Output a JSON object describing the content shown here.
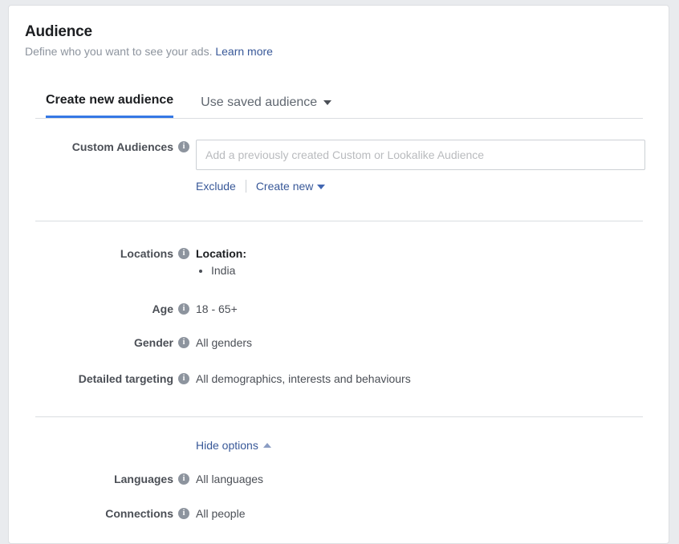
{
  "header": {
    "title": "Audience",
    "subtitle": "Define who you want to see your ads.",
    "learn_more": "Learn more"
  },
  "tabs": [
    {
      "label": "Create new audience",
      "active": true
    },
    {
      "label": "Use saved audience",
      "active": false,
      "icon": "chevron-down-icon"
    }
  ],
  "custom_audiences": {
    "label": "Custom Audiences",
    "info_icon": "info-icon",
    "input_value": "",
    "placeholder": "Add a previously created Custom or Lookalike Audience",
    "exclude_link": "Exclude",
    "create_new_link": "Create new",
    "create_new_icon": "caret-down-icon"
  },
  "locations": {
    "label": "Locations",
    "value_title": "Location:",
    "items": [
      "India"
    ]
  },
  "age": {
    "label": "Age",
    "value": "18 - 65+"
  },
  "gender": {
    "label": "Gender",
    "value": "All genders"
  },
  "detailed_targeting": {
    "label": "Detailed targeting",
    "value": "All demographics, interests and behaviours"
  },
  "options_toggle": {
    "label": "Hide options",
    "icon": "caret-up-icon"
  },
  "languages": {
    "label": "Languages",
    "value": "All languages"
  },
  "connections": {
    "label": "Connections",
    "value": "All people"
  },
  "icons": {
    "info": "i"
  },
  "colors": {
    "accent": "#3578e5",
    "link": "#385898",
    "label": "#4b4f56",
    "muted": "#8d949e"
  }
}
